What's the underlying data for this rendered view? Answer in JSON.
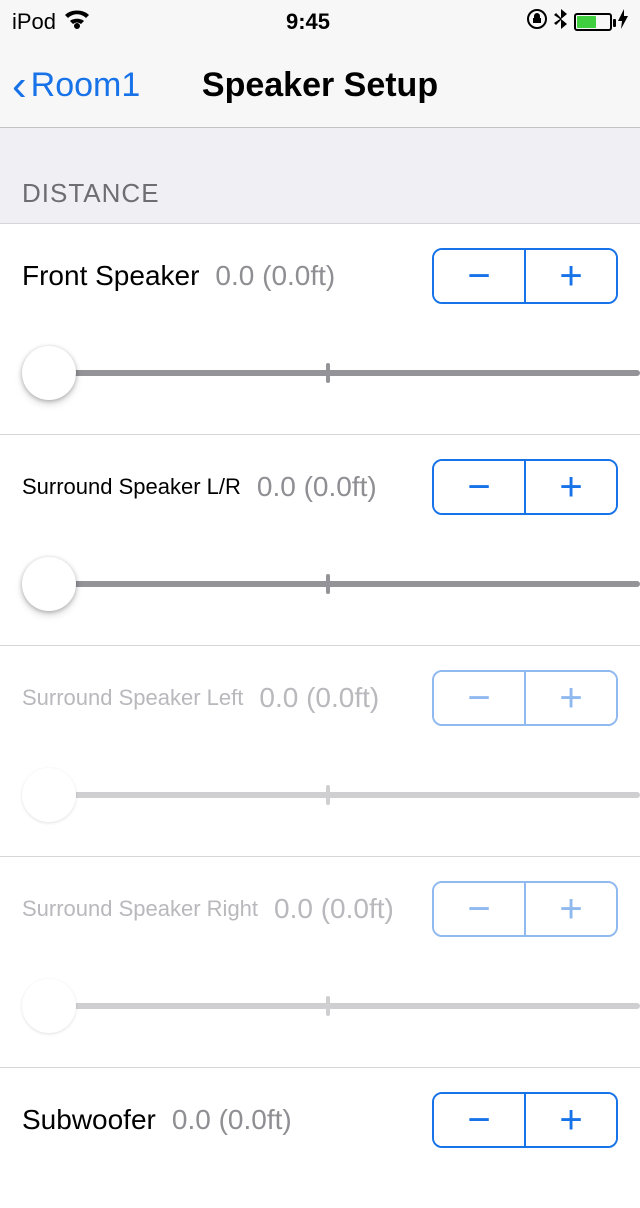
{
  "status": {
    "device": "iPod",
    "time": "9:45"
  },
  "nav": {
    "back_label": "Room1",
    "title": "Speaker Setup"
  },
  "section": {
    "header": "DISTANCE"
  },
  "speakers": [
    {
      "label": "Front Speaker",
      "value": "0.0 (0.0ft)",
      "big": true,
      "disabled": false
    },
    {
      "label": "Surround Speaker L/R",
      "value": "0.0 (0.0ft)",
      "big": false,
      "disabled": false
    },
    {
      "label": "Surround Speaker Left",
      "value": "0.0 (0.0ft)",
      "big": false,
      "disabled": true
    },
    {
      "label": "Surround Speaker Right",
      "value": "0.0 (0.0ft)",
      "big": false,
      "disabled": true
    },
    {
      "label": "Subwoofer",
      "value": "0.0 (0.0ft)",
      "big": true,
      "disabled": false
    }
  ],
  "stepper": {
    "minus": "−",
    "plus": "+"
  }
}
